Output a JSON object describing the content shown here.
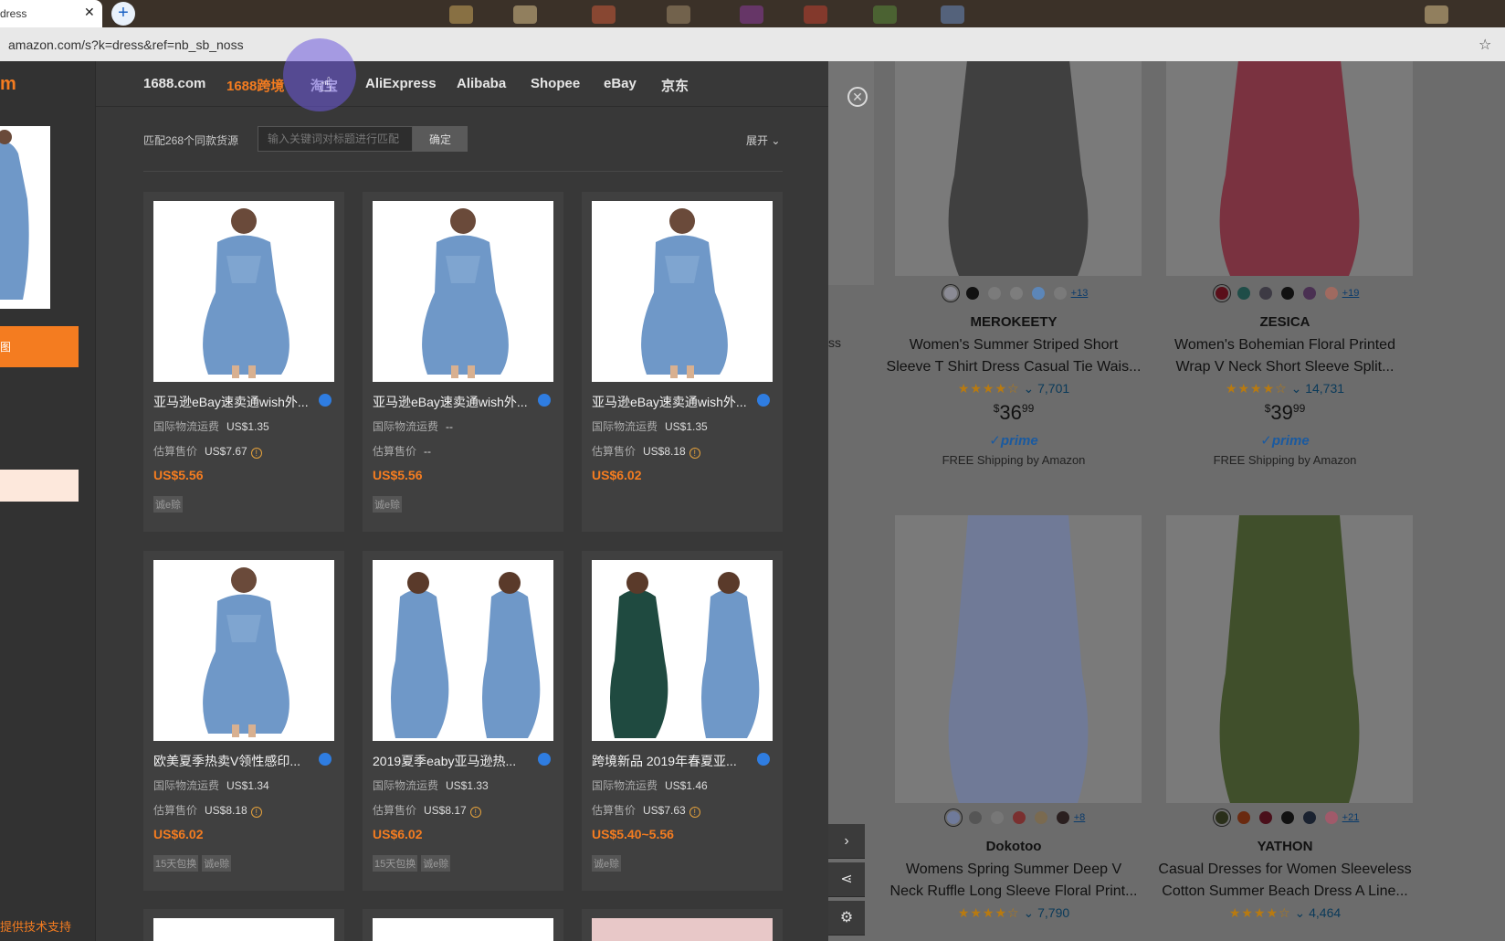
{
  "browser": {
    "tab_title": "dress",
    "tab_close": "✕",
    "new_tab": "+",
    "url": "amazon.com/s?k=dress&ref=nb_sb_noss",
    "star": "☆"
  },
  "plugin": {
    "brand": "m",
    "side_button": "图",
    "tech_support": "提供技术支持",
    "sites": [
      {
        "label": "1688.com",
        "active": false
      },
      {
        "label": "1688跨境",
        "active": true
      },
      {
        "label": "淘宝",
        "active": false
      },
      {
        "label": "AliExpress",
        "active": false
      },
      {
        "label": "Alibaba",
        "active": false
      },
      {
        "label": "Shopee",
        "active": false
      },
      {
        "label": "eBay",
        "active": false
      },
      {
        "label": "京东",
        "active": false
      }
    ],
    "match_text": "匹配268个同款货源",
    "keyword_placeholder": "输入关键词对标题进行匹配",
    "confirm": "确定",
    "expand": "展开",
    "shipping_label": "国际物流运费",
    "estimate_label": "估算售价",
    "products": [
      {
        "title": "亚马逊eBay速卖通wish外...",
        "shipping": "US$1.35",
        "estimate": "US$7.67",
        "estimate_info": true,
        "price": "US$5.56",
        "tags": [
          "诚e赊"
        ],
        "img": "blue"
      },
      {
        "title": "亚马逊eBay速卖通wish外...",
        "shipping": "--",
        "estimate": "--",
        "estimate_info": false,
        "price": "US$5.56",
        "tags": [
          "诚e赊"
        ],
        "img": "blue"
      },
      {
        "title": "亚马逊eBay速卖通wish外...",
        "shipping": "US$1.35",
        "estimate": "US$8.18",
        "estimate_info": true,
        "price": "US$6.02",
        "tags": [],
        "img": "blue"
      },
      {
        "title": "欧美夏季热卖V领性感印...",
        "shipping": "US$1.34",
        "estimate": "US$8.18",
        "estimate_info": true,
        "price": "US$6.02",
        "tags": [
          "15天包换",
          "诚e赊"
        ],
        "img": "blue"
      },
      {
        "title": "2019夏季eaby亚马逊热...",
        "shipping": "US$1.33",
        "estimate": "US$8.17",
        "estimate_info": true,
        "price": "US$6.02",
        "tags": [
          "15天包换",
          "诚e赊"
        ],
        "img": "blue2"
      },
      {
        "title": "跨境新品 2019年春夏亚...",
        "shipping": "US$1.46",
        "estimate": "US$7.63",
        "estimate_info": true,
        "price": "US$5.40~5.56",
        "tags": [
          "诚e赊"
        ],
        "img": "green"
      }
    ]
  },
  "amazon": {
    "left_fragment_1": "ss",
    "left_fragment_2": "..",
    "close_icon": "✕",
    "products": [
      {
        "brand": "MEROKEETY",
        "title_1": "Women's Summer Striped Short",
        "title_2": "Sleeve T Shirt Dress Casual Tie Wais...",
        "rating_count": "7,701",
        "stars": "★★★★☆",
        "price_main": "36",
        "price_cents": "99",
        "prime": "✓prime",
        "shipping": "FREE Shipping by Amazon",
        "more_colors": "+13",
        "swatches": [
          "#8a8a94",
          "#111111",
          "#7b7b7b",
          "#7d7d7d",
          "#5c86b8",
          "#7a7a7a"
        ]
      },
      {
        "brand": "ZESICA",
        "title_1": "Women's Bohemian Floral Printed",
        "title_2": "Wrap V Neck Short Sleeve Split...",
        "rating_count": "14,731",
        "stars": "★★★★☆",
        "price_main": "39",
        "price_cents": "99",
        "prime": "✓prime",
        "shipping": "FREE Shipping by Amazon",
        "more_colors": "+19",
        "swatches": [
          "#5a0f1a",
          "#1f4d48",
          "#3d3a44",
          "#111111",
          "#4a3052",
          "#a06a60"
        ]
      },
      {
        "brand": "Dokotoo",
        "title_1": "Womens Spring Summer Deep V",
        "title_2": "Neck Ruffle Long Sleeve Floral Print...",
        "rating_count": "7,790",
        "stars": "★★★★☆",
        "more_colors": "+8",
        "swatches": [
          "#6f7a9a",
          "#555555",
          "#777777",
          "#7a3030",
          "#7a6a50",
          "#2a1f1f"
        ]
      },
      {
        "brand": "YATHON",
        "title_1": "Casual Dresses for Women Sleeveless",
        "title_2": "Cotton Summer Beach Dress A Line...",
        "rating_count": "4,464",
        "stars": "★★★★☆",
        "more_colors": "+21",
        "swatches": [
          "#2a2f1a",
          "#6a2a10",
          "#4a0f1a",
          "#111111",
          "#1a2230",
          "#a05a6a"
        ]
      }
    ]
  },
  "tools": {
    "next": "›",
    "share": "⋖",
    "settings": "⚙"
  }
}
